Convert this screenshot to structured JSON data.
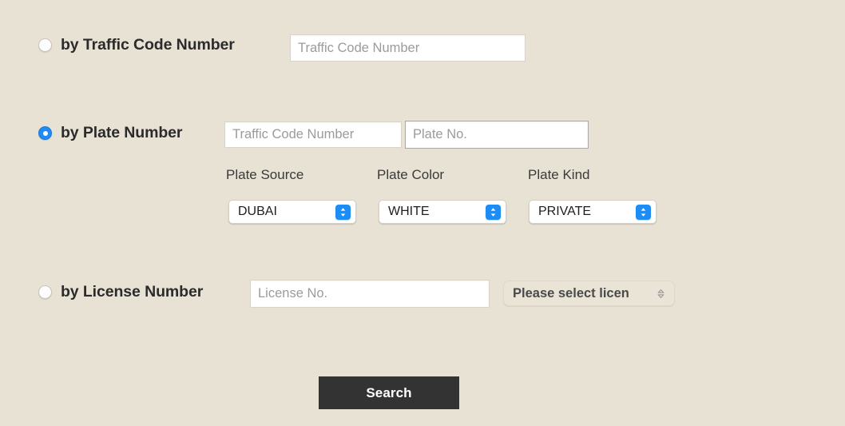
{
  "page": {
    "background_color": "#e8e2d4",
    "accent_color": "#1e8cf5",
    "button_color": "#333333"
  },
  "options": {
    "traffic_code": {
      "label": "by Traffic Code Number",
      "radio_state": "unselected",
      "input_placeholder": "Traffic Code Number",
      "input_value": ""
    },
    "plate_number": {
      "label": "by Plate Number",
      "radio_state": "selected",
      "traffic_code_placeholder": "Traffic Code Number",
      "traffic_code_value": "",
      "plate_no_placeholder": "Plate No.",
      "plate_no_value": "",
      "fields": {
        "plate_source": {
          "label": "Plate Source",
          "selected": "DUBAI"
        },
        "plate_color": {
          "label": "Plate Color",
          "selected": "WHITE"
        },
        "plate_kind": {
          "label": "Plate Kind",
          "selected": "PRIVATE"
        }
      }
    },
    "license_number": {
      "label": "by License Number",
      "radio_state": "unselected",
      "input_placeholder": "License No.",
      "input_value": "",
      "license_source": {
        "selected": "Please select licen",
        "disabled": true
      }
    }
  },
  "actions": {
    "search_label": "Search"
  }
}
